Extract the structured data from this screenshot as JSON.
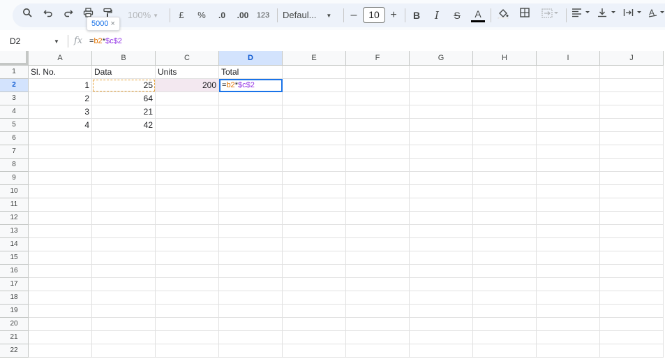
{
  "toolbar": {
    "zoom": "100%",
    "currency": "£",
    "percent": "%",
    "decrease_decimal": ".0",
    "increase_decimal": ".00",
    "number_format": "123",
    "font_family": "Defaul...",
    "font_size": "10",
    "minus": "–",
    "plus": "+",
    "bold": "B",
    "italic": "I",
    "strikethrough": "S",
    "text_color_letter": "A"
  },
  "tooltip": {
    "value": "5000",
    "close": "×"
  },
  "formula_bar": {
    "name_box": "D2",
    "fx": "fx",
    "formula_parts": [
      {
        "text": "=",
        "kind": "op"
      },
      {
        "text": "b2",
        "kind": "ref1"
      },
      {
        "text": "*",
        "kind": "op"
      },
      {
        "text": "$c$2",
        "kind": "ref2"
      }
    ]
  },
  "columns": [
    "A",
    "B",
    "C",
    "D",
    "E",
    "F",
    "G",
    "H",
    "I",
    "J"
  ],
  "selected_column": "D",
  "rows": [
    "1",
    "2",
    "3",
    "4",
    "5",
    "6",
    "7",
    "8",
    "9",
    "10",
    "11",
    "12",
    "13",
    "14",
    "15",
    "16",
    "17",
    "18",
    "19",
    "20",
    "21",
    "22"
  ],
  "selected_row": "2",
  "cells": {
    "A1": "Sl. No.",
    "B1": "Data",
    "C1": "Units",
    "D1": "Total",
    "A2": "1",
    "B2": "25",
    "C2": "200",
    "A3": "2",
    "B3": "64",
    "A4": "3",
    "B4": "21",
    "A5": "4",
    "B5": "42"
  },
  "active_cell_formula": [
    {
      "text": "=",
      "kind": "op"
    },
    {
      "text": "b2",
      "kind": "ref1"
    },
    {
      "text": "*",
      "kind": "op"
    },
    {
      "text": "$c$2",
      "kind": "ref2"
    }
  ],
  "colors": {
    "accent": "#1a73e8",
    "ref1": "#e37400",
    "ref2": "#9334e6",
    "toolbar_bg": "#edf2fa"
  }
}
